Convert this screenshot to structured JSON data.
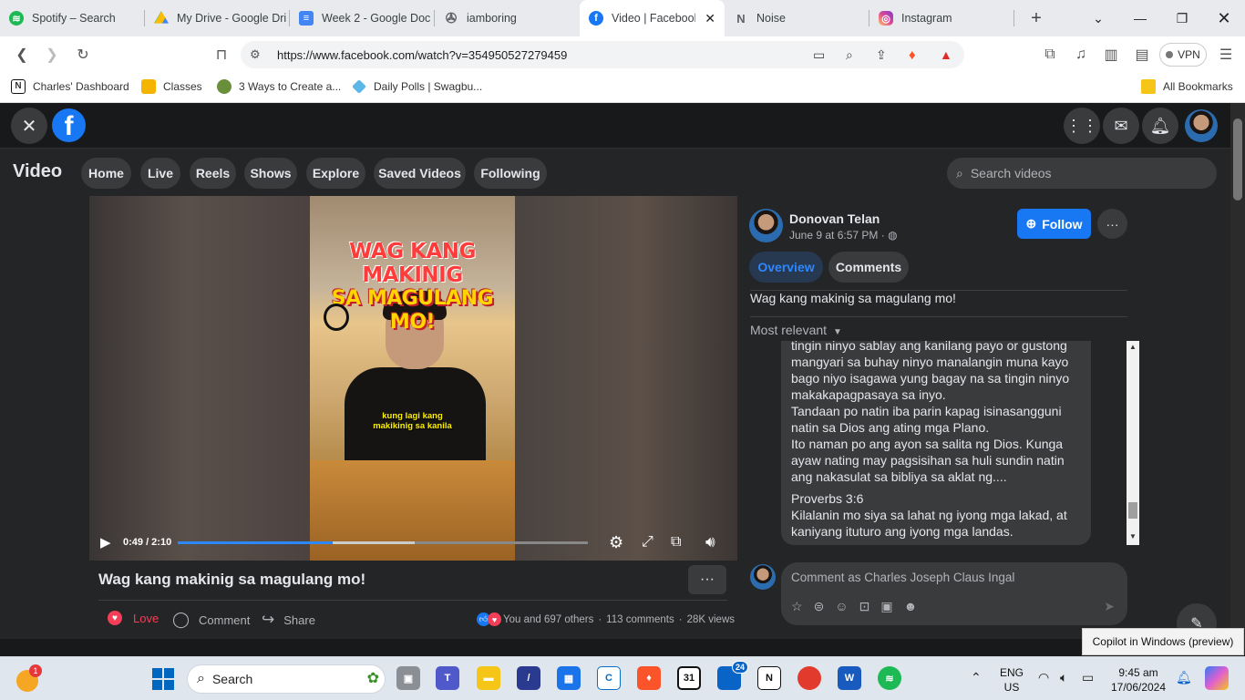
{
  "browser": {
    "tabs": [
      {
        "label": "Spotify – Search",
        "icon": "spotify-icon",
        "color": "#1db954"
      },
      {
        "label": "My Drive - Google Dri",
        "icon": "google-drive-icon",
        "color": "#fbbc04"
      },
      {
        "label": "Week 2 - Google Doc",
        "icon": "google-docs-icon",
        "color": "#4285f4"
      },
      {
        "label": "iamboring",
        "icon": "pinwheel-icon",
        "color": "#5f6368"
      },
      {
        "label": "Video | Facebook",
        "icon": "facebook-icon",
        "color": "#1877f2"
      },
      {
        "label": "Noise",
        "icon": "notion-icon",
        "color": "#5f6368"
      },
      {
        "label": "Instagram",
        "icon": "instagram-icon",
        "color": "#d6249f"
      }
    ],
    "active_tab": 4,
    "url": "https://www.facebook.com/watch?v=354950527279459",
    "vpn_label": "VPN",
    "bookmarks": [
      {
        "label": "Charles' Dashboard",
        "icon": "notion-icon"
      },
      {
        "label": "Classes",
        "icon": "classroom-icon"
      },
      {
        "label": "3 Ways to Create a...",
        "icon": "site-icon"
      },
      {
        "label": "Daily Polls | Swagbu...",
        "icon": "swagbucks-icon"
      }
    ],
    "all_bookmarks": "All Bookmarks"
  },
  "facebook": {
    "nav_title": "Video",
    "nav_pills": [
      "Home",
      "Live",
      "Reels",
      "Shows",
      "Explore",
      "Saved Videos",
      "Following"
    ],
    "search_placeholder": "Search videos",
    "video": {
      "overlay_line1": "WAG KANG MAKINIG",
      "overlay_line2": "SA MAGULANG MO!",
      "caption_line1": "kung lagi kang",
      "caption_line2": "makikinig sa kanila",
      "time": "0:49 / 2:10",
      "progress_fraction": 0.377,
      "buffered_fraction": 0.578,
      "title": "Wag kang makinig sa magulang mo!"
    },
    "actions": {
      "love": "Love",
      "comment": "Comment",
      "share": "Share"
    },
    "stats": {
      "reactions": "You and 697 others",
      "comments": "113 comments",
      "views": "28K views"
    },
    "post": {
      "author": "Donovan Telan",
      "date": "June 9 at 6:57 PM · ",
      "follow": "Follow",
      "tab_overview": "Overview",
      "tab_comments": "Comments",
      "description": "Wag kang makinig sa magulang mo!",
      "sort": "Most relevant",
      "comment_paragraph1": "tingin ninyo sablay ang kanilang payo or gustong mangyari sa buhay ninyo manalangin muna kayo bago niyo isagawa yung bagay na sa tingin ninyo makakapagpasaya sa inyo.",
      "comment_paragraph2": "Tandaan po natin iba parin kapag isinasangguni natin sa Dios ang ating mga Plano.",
      "comment_paragraph3": "Ito naman po ang ayon sa salita ng Dios. Kunga ayaw nating may pagsisihan sa huli sundin natin ang nakasulat sa bibliya sa aklat ng....",
      "comment_verse_ref": "Proverbs 3:6",
      "comment_verse": "Kilalanin mo siya sa lahat ng iyong mga lakad, at kaniyang ituturo ang iyong mga landas.",
      "comment_placeholder": "Comment as Charles Joseph Claus Ingal"
    },
    "tooltip": "Copilot in Windows (preview)"
  },
  "taskbar": {
    "search_label": "Search",
    "notification_badge": "1",
    "outlook_badge": "24",
    "calendar_day": "31",
    "lang_line1": "ENG",
    "lang_line2": "US",
    "time": "9:45 am",
    "date": "17/06/2024"
  }
}
